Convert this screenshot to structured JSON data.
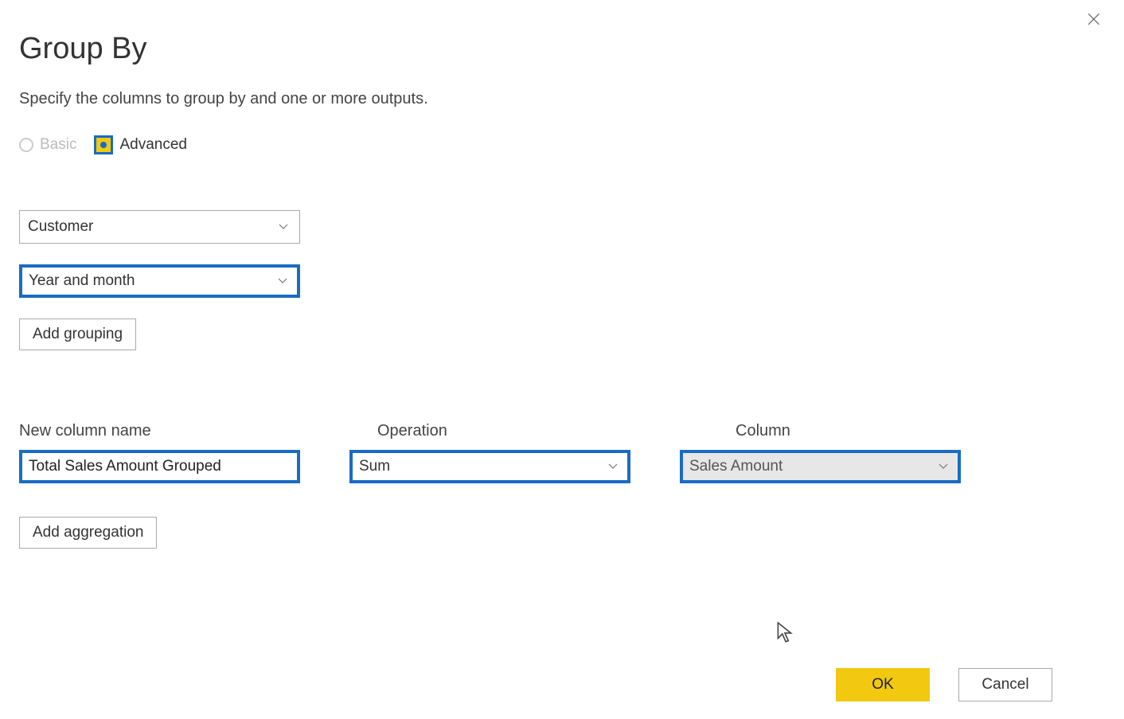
{
  "dialog": {
    "title": "Group By",
    "subtitle": "Specify the columns to group by and one or more outputs."
  },
  "mode": {
    "basic_label": "Basic",
    "advanced_label": "Advanced"
  },
  "grouping_dropdowns": [
    {
      "value": "Customer",
      "highlighted": false
    },
    {
      "value": "Year and month",
      "highlighted": true
    }
  ],
  "buttons": {
    "add_grouping": "Add grouping",
    "add_aggregation": "Add aggregation",
    "ok": "OK",
    "cancel": "Cancel"
  },
  "aggregation": {
    "headers": {
      "new_column": "New column name",
      "operation": "Operation",
      "column": "Column"
    },
    "row": {
      "new_column_value": "Total Sales Amount Grouped",
      "operation_value": "Sum",
      "column_value": "Sales Amount"
    }
  }
}
